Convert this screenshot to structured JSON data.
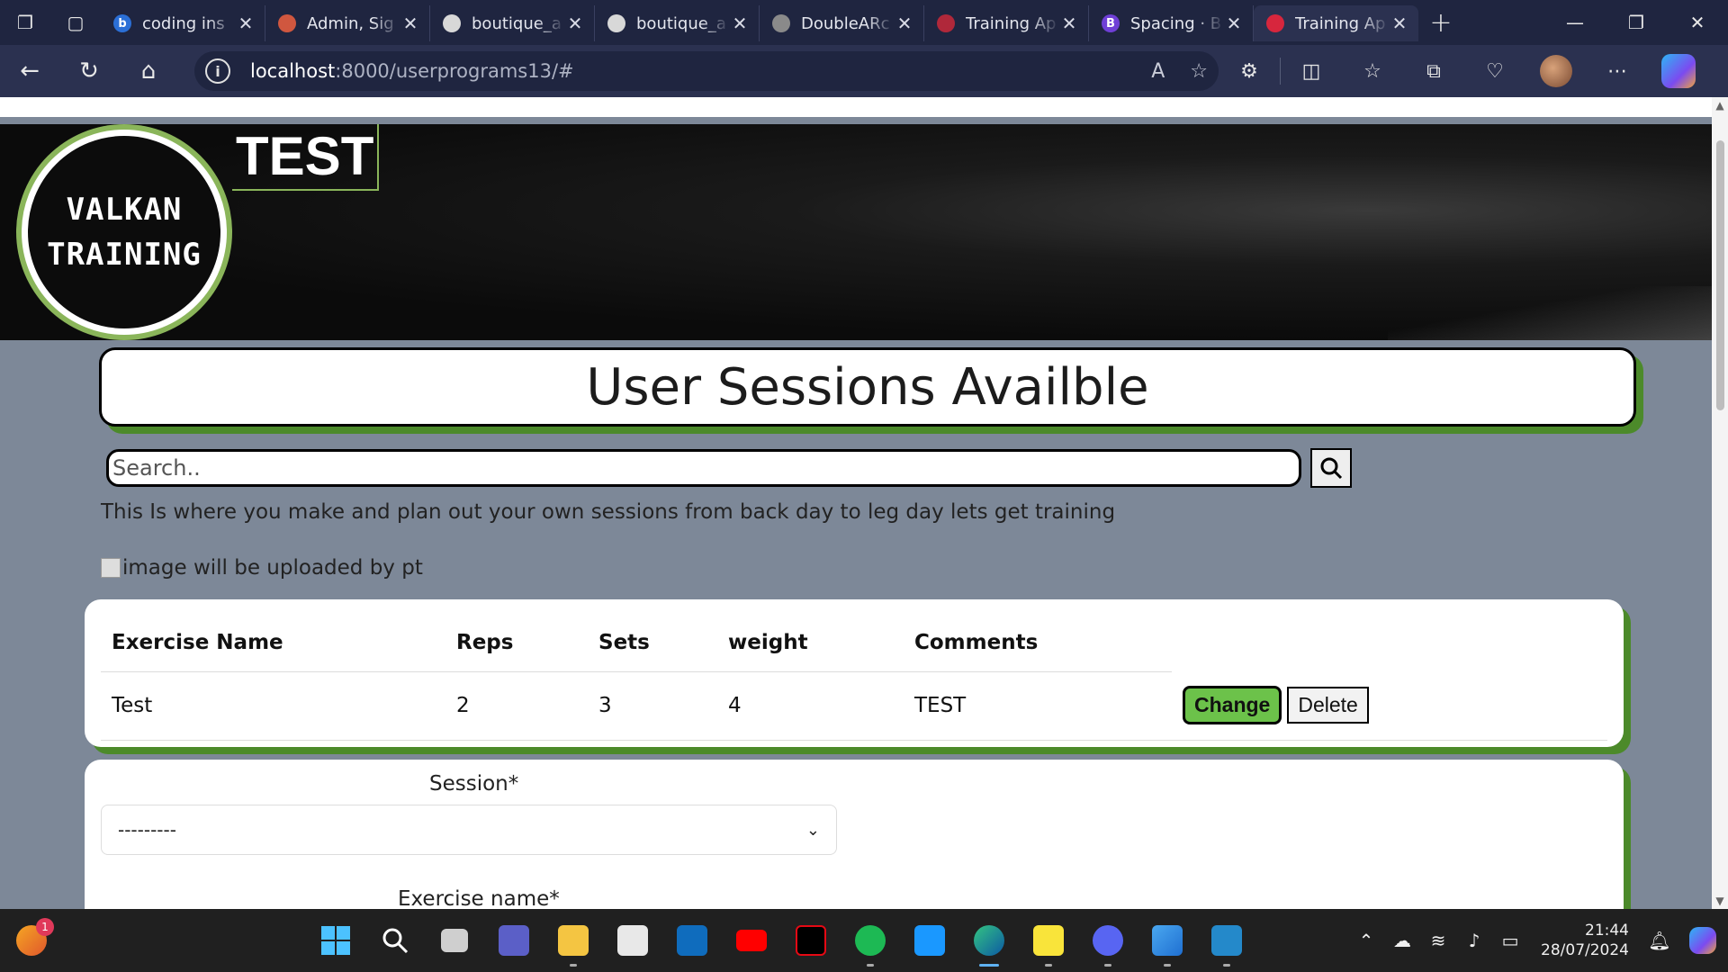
{
  "browser": {
    "tabs": [
      {
        "title": "coding ins",
        "color": "#2b6fd6",
        "glyph": "b"
      },
      {
        "title": "Admin, Sig",
        "color": "#d0573f",
        "glyph": ""
      },
      {
        "title": "boutique_a",
        "color": "#d8d8d8",
        "glyph": ""
      },
      {
        "title": "boutique_a",
        "color": "#d8d8d8",
        "glyph": ""
      },
      {
        "title": "DoubleARc",
        "color": "#8a8a8a",
        "glyph": ""
      },
      {
        "title": "Training Ap",
        "color": "#b0283a",
        "glyph": ""
      },
      {
        "title": "Spacing · B",
        "color": "#6f3fd6",
        "glyph": "B"
      },
      {
        "title": "Training Ap",
        "color": "#d7263d",
        "glyph": ""
      }
    ],
    "url_host": "localhost",
    "url_rest": ":8000/userprograms13/#"
  },
  "hero": {
    "logo_line1": "VALKAN",
    "logo_line2": "TRAINING",
    "title": "TEST"
  },
  "page": {
    "heading": "User Sessions Availble",
    "search_placeholder": "Search..",
    "intro": "This Is where you make and plan out your own sessions from back day to leg day lets get training",
    "image_alt": "image will be uploaded by pt"
  },
  "table": {
    "headers": [
      "Exercise Name",
      "Reps",
      "Sets",
      "weight",
      "Comments"
    ],
    "rows": [
      {
        "name": "Test",
        "reps": "2",
        "sets": "3",
        "weight": "4",
        "comments": "TEST"
      }
    ],
    "change_label": "Change",
    "delete_label": "Delete"
  },
  "form": {
    "session_label": "Session*",
    "session_value": "---------",
    "exercise_label": "Exercise name*"
  },
  "taskbar": {
    "weather_badge": "1",
    "time": "21:44",
    "date": "28/07/2024"
  },
  "colors": {
    "accent_green": "#4c8a2a",
    "button_green": "#6cc24a",
    "page_bg": "#7d8898"
  }
}
